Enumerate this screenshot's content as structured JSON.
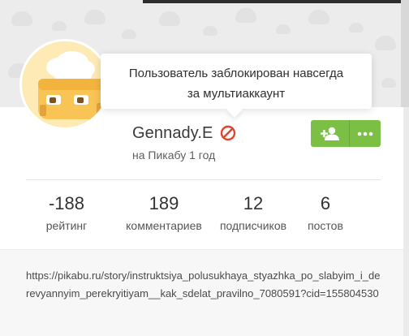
{
  "tooltip": {
    "text": "Пользователь заблокирован навсегда\nза мультиаккаунт"
  },
  "profile": {
    "username": "Gennady.E",
    "registered": "на Пикабу 1 год",
    "status_icon": "ban-icon",
    "status_color": "#e0452f"
  },
  "actions": {
    "subscribe_icon": "add-user-icon",
    "more_icon": "more-dots-icon",
    "accent_color": "#7bc045"
  },
  "stats": [
    {
      "value": "-188",
      "label": "рейтинг"
    },
    {
      "value": "189",
      "label": "комментариев"
    },
    {
      "value": "12",
      "label": "подписчиков"
    },
    {
      "value": "6",
      "label": "постов"
    }
  ],
  "link": {
    "url": "https://pikabu.ru/story/instruktsiya_polusukhaya_styazhka_po_slabyim_i_derevyannyim_perekryitiyam__kak_sdelat_pravilno_7080591?cid=155804530"
  }
}
